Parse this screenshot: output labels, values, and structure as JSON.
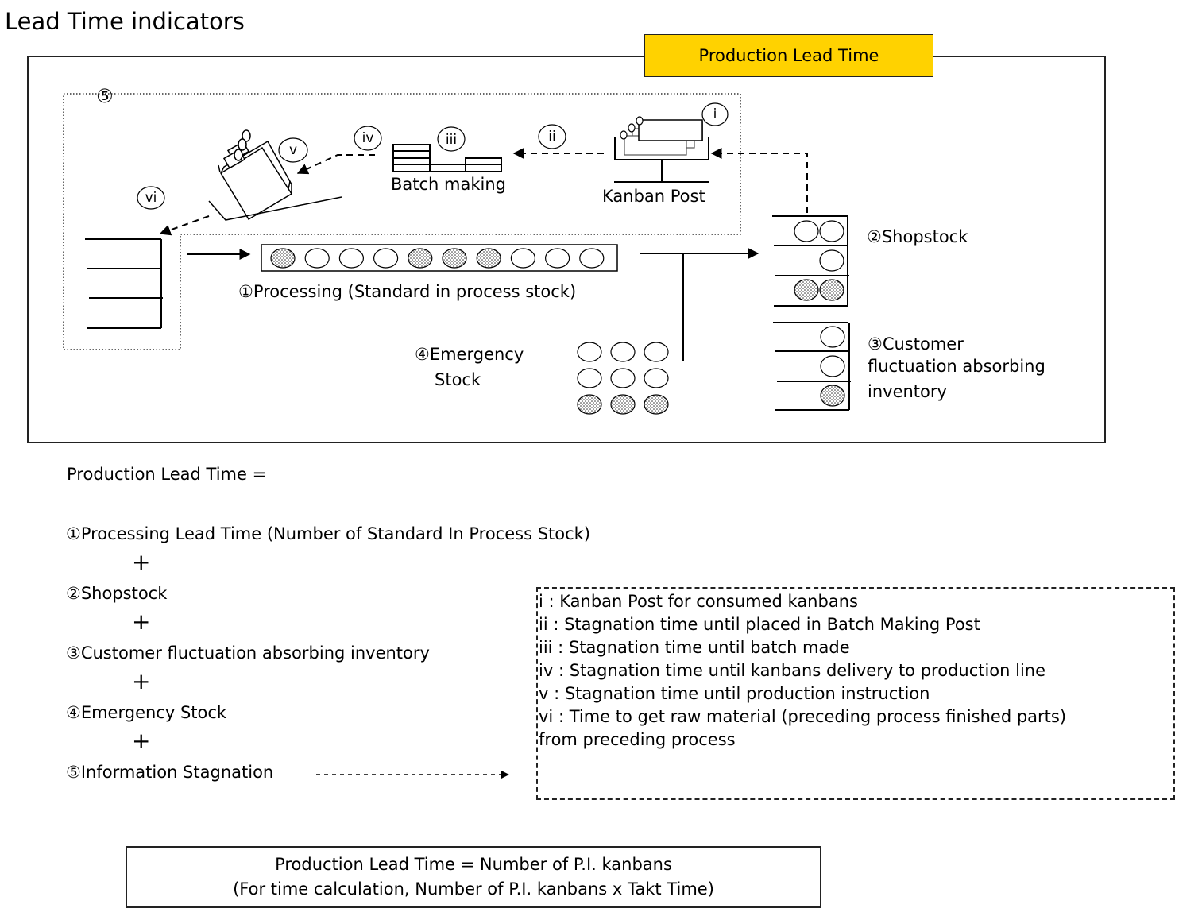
{
  "page": {
    "title": "Lead Time indicators"
  },
  "diagram": {
    "frame_label": "Production Lead Time",
    "frame_label_color": "#FFD200",
    "info_group_marker": "⑤",
    "roman_markers": {
      "i": "i",
      "ii": "ii",
      "iii": "iii",
      "iv": "iv",
      "v": "v",
      "vi": "vi"
    },
    "kanban_post_label": "Kanban Post",
    "batch_making_label": "Batch making",
    "processing_label": "①Processing (Standard in process stock)",
    "processing_stock": [
      "filled",
      "empty",
      "empty",
      "empty",
      "filled",
      "filled",
      "filled",
      "empty",
      "empty",
      "empty"
    ],
    "shopstock_label": "②Shopstock",
    "shopstock_shelves": [
      [
        "empty",
        "empty"
      ],
      [
        "empty"
      ],
      [
        "filled",
        "filled"
      ]
    ],
    "customer_inventory_label_lines": [
      "③Customer",
      "fluctuation absorbing",
      "inventory"
    ],
    "customer_inventory_shelves": [
      [
        "empty"
      ],
      [
        "empty"
      ],
      [
        "filled"
      ]
    ],
    "emergency_label_lines": [
      "④Emergency",
      "Stock"
    ],
    "emergency_stock_grid": [
      [
        "empty",
        "empty",
        "empty"
      ],
      [
        "empty",
        "empty",
        "empty"
      ],
      [
        "filled",
        "filled",
        "filled"
      ]
    ]
  },
  "formula": {
    "heading": "Production Lead Time =",
    "terms": [
      "①Processing Lead Time (Number of Standard In Process Stock)",
      "②Shopstock",
      "③Customer fluctuation absorbing inventory",
      "④Emergency Stock",
      "⑤Information Stagnation"
    ],
    "operator": "+"
  },
  "legend": {
    "items": [
      "i  : Kanban Post for consumed kanbans",
      "ii  : Stagnation time until placed in Batch Making Post",
      "iii : Stagnation time until batch made",
      "iv : Stagnation time until kanbans delivery to production line",
      "v   : Stagnation time until production instruction",
      "vi  : Time to get raw material (preceding process finished parts)",
      "      from preceding process"
    ]
  },
  "summary": {
    "line1": "Production Lead Time = Number of P.I. kanbans",
    "line2": "(For time calculation, Number of P.I. kanbans x Takt Time)"
  }
}
